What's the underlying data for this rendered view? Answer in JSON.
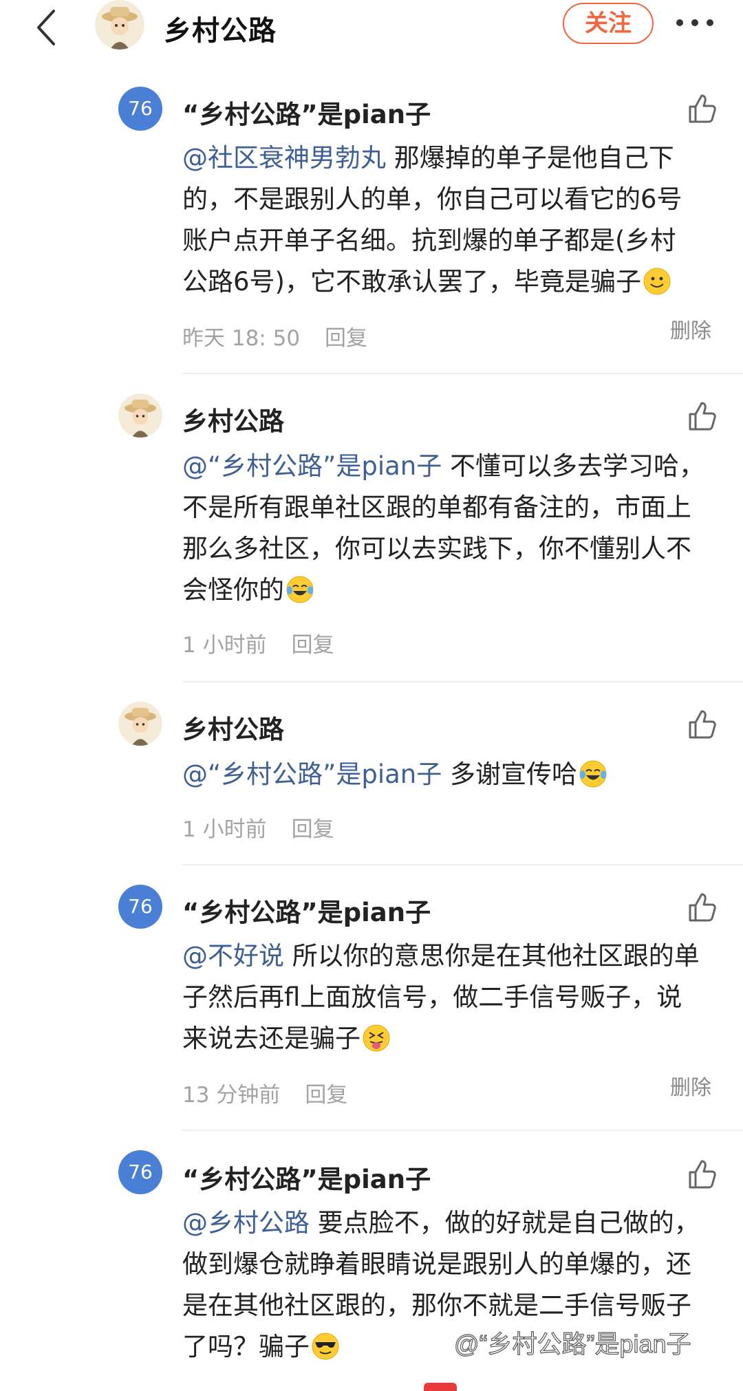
{
  "header": {
    "title": "乡村公路",
    "follow_label": "关注"
  },
  "comments": [
    {
      "avatar_text": "76",
      "author": "“乡村公路”是pian子",
      "mention": "@社区衰神男勃丸",
      "body_lines": [
        "那爆掉的单子是他自己下",
        "的，不是跟别人的单，你自己可以看它的6号",
        "账户点开单子名细。抗到爆的单子都是(乡村",
        "公路6号)，它不敢承认罢了，毕竟是骗子"
      ],
      "emoji": "slightly-smiling-face",
      "time": "昨天 18: 50",
      "reply_label": "回复",
      "delete_label": "删除"
    },
    {
      "avatar_text": "",
      "author": "乡村公路",
      "mention": "@“乡村公路”是pian子",
      "body_lines": [
        "不懂可以多去学习哈，",
        "不是所有跟单社区跟的单都有备注的，市面上",
        "那么多社区，你可以去实践下，你不懂别人不",
        "会怪你的"
      ],
      "emoji": "tears-of-joy",
      "time": "1 小时前",
      "reply_label": "回复"
    },
    {
      "avatar_text": "",
      "author": "乡村公路",
      "mention": "@“乡村公路”是pian子",
      "body_lines": [
        "多谢宣传哈"
      ],
      "emoji": "tears-of-joy",
      "time": "1 小时前",
      "reply_label": "回复"
    },
    {
      "avatar_text": "76",
      "author": "“乡村公路”是pian子",
      "mention": "@不好说",
      "body_lines": [
        "所以你的意思你是在其他社区跟的单",
        "子然后再fl上面放信号，做二手信号贩子，说",
        "来说去还是骗子"
      ],
      "emoji": "squinting-tongue",
      "time": "13 分钟前",
      "reply_label": "回复",
      "delete_label": "删除"
    },
    {
      "avatar_text": "76",
      "author": "“乡村公路”是pian子",
      "mention": "@乡村公路",
      "body_lines": [
        "要点脸不，做的好就是自己做的，",
        "做到爆仓就睁着眼睛说是跟别人的单爆的，还",
        "是在其他社区跟的，那你不就是二手信号贩子",
        "了吗？骗子"
      ],
      "emoji": "sunglasses",
      "time": "",
      "reply_label": ""
    }
  ],
  "watermark": "@“乡村公路”是pian子",
  "colors": {
    "accent": "#f0663e",
    "mention": "#3e5f96",
    "avatar_blue": "#4a7fd6",
    "meta_gray": "#a3a3a3"
  }
}
